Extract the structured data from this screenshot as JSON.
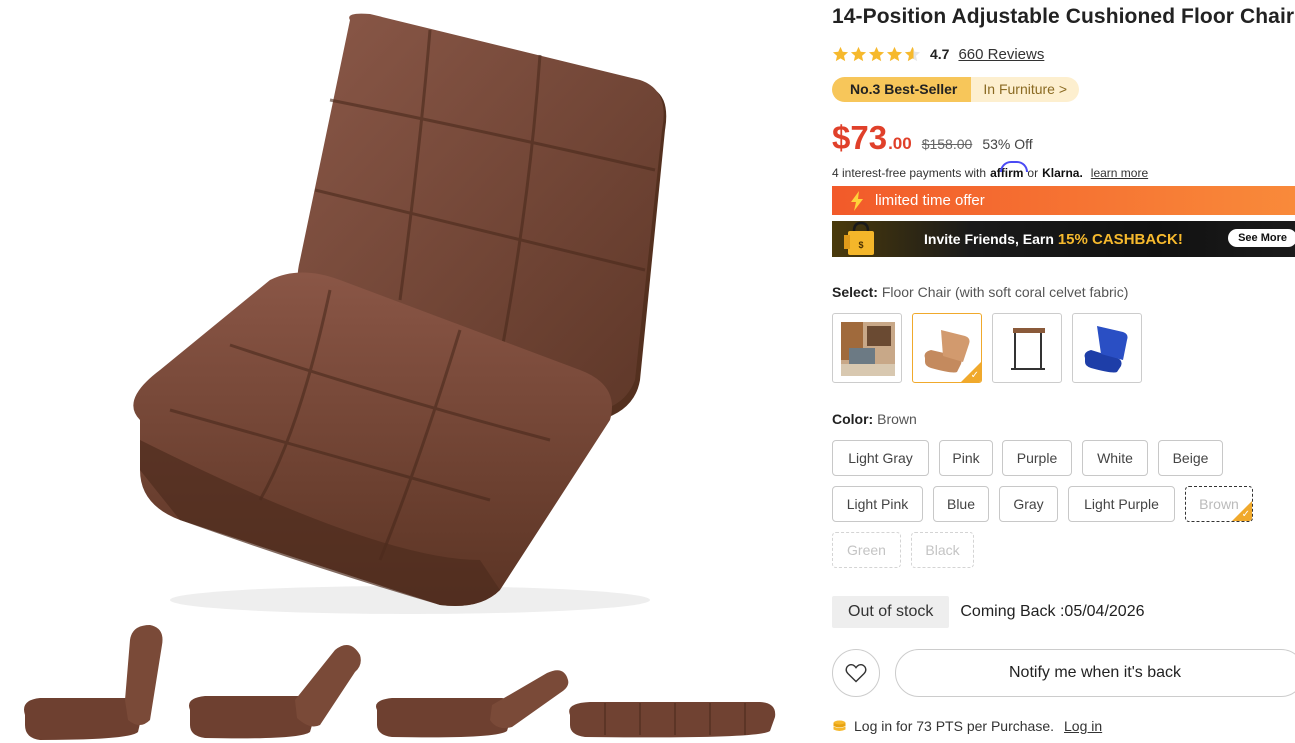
{
  "product": {
    "title": "14-Position Adjustable Cushioned Floor Chair",
    "rating": "4.7",
    "rating_value": 4.7,
    "reviews": "660 Reviews"
  },
  "bestseller": {
    "rank": "No.3 Best-Seller",
    "category": "In Furniture >"
  },
  "price": {
    "main": "$73",
    "cents": ".00",
    "original": "$158.00",
    "discount": "53% Off"
  },
  "payments": {
    "prefix": "4 interest-free payments with",
    "affirm": "affirm",
    "or": "or",
    "klarna": "Klarna.",
    "learn_more": "learn more"
  },
  "promo": {
    "limited": "limited time offer",
    "invite_prefix": "Invite Friends, Earn",
    "invite_cash": "15% CASHBACK!",
    "see_more": "See More"
  },
  "select": {
    "label": "Select:",
    "value": "Floor Chair (with soft coral celvet fabric)"
  },
  "variants": [
    "Room scene",
    "Floor Chair",
    "Side Table",
    "Blue Floor Chair"
  ],
  "color": {
    "label": "Color:",
    "value": "Brown",
    "options": [
      "Light Gray",
      "Pink",
      "Purple",
      "White",
      "Beige",
      "Light Pink",
      "Blue",
      "Gray",
      "Light Purple",
      "Brown",
      "Green",
      "Black"
    ]
  },
  "stock": {
    "status": "Out of stock",
    "coming_back": "Coming Back :05/04/2026"
  },
  "actions": {
    "notify": "Notify me when it's back"
  },
  "points": {
    "text": "Log in for 73 PTS per Purchase.",
    "login": "Log in"
  },
  "icons": {
    "star": "star-icon",
    "bolt": "bolt-icon",
    "heart": "heart-icon",
    "coin": "coin-icon",
    "gift": "gift-bag-icon",
    "check": "check-icon"
  },
  "colors": {
    "accent": "#e0402a",
    "star": "#f6b92d",
    "bestseller": "#f7c65a",
    "selected": "#f0a92c",
    "chair": "#7a4a3a"
  }
}
